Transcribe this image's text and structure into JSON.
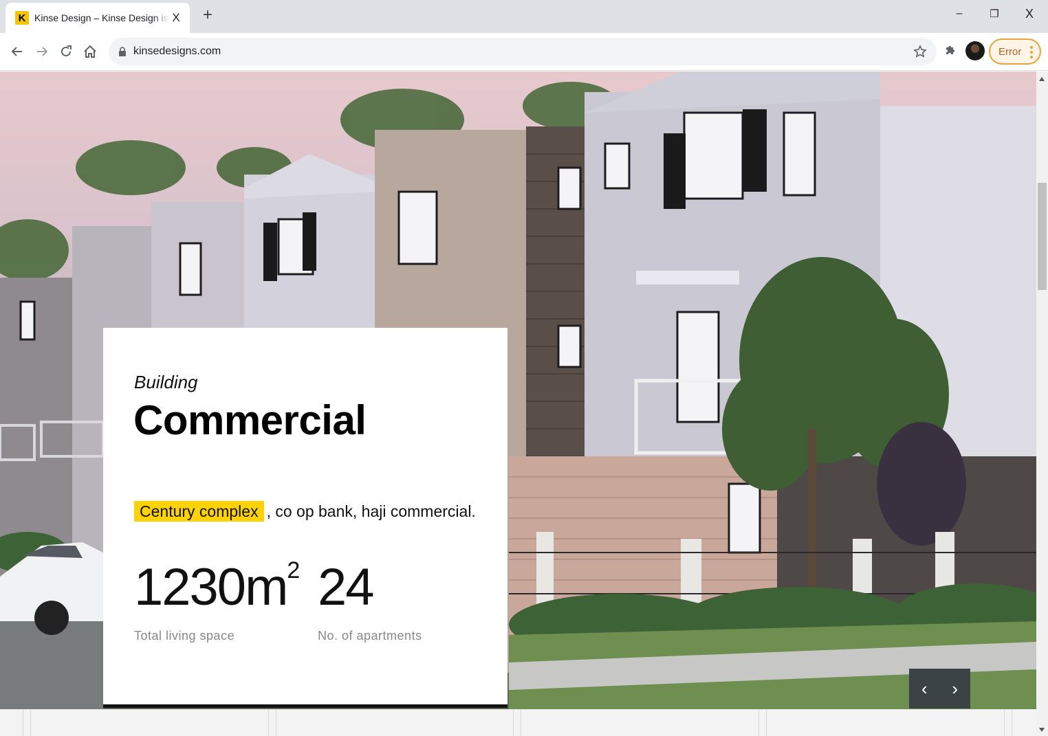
{
  "browser": {
    "tab": {
      "favicon_letter": "K",
      "title": "Kinse Design – Kinse Design is a l",
      "close_glyph": "X"
    },
    "new_tab_glyph": "+",
    "window_controls": {
      "minimize_glyph": "–",
      "restore_glyph": "❐",
      "close_glyph": "X"
    },
    "address": {
      "url": "kinsedesigns.com"
    },
    "profile_status": "Error",
    "accent_colors": {
      "error_border": "#e8a33a",
      "tab_bar": "#dee1e6"
    }
  },
  "page": {
    "card": {
      "eyebrow": "Building",
      "headline": "Commercial",
      "clients_highlight": "Century complex",
      "clients_rest": ", co op bank, haji commercial."
    },
    "stats": [
      {
        "value": "1230m",
        "superscript": "2",
        "label": "Total living space"
      },
      {
        "value": "24",
        "superscript": "",
        "label": "No. of apartments"
      }
    ],
    "slider": {
      "prev_glyph": "‹",
      "next_glyph": "›"
    },
    "colors": {
      "highlight": "#ffd200",
      "slider_controls": "#3b4347"
    }
  }
}
